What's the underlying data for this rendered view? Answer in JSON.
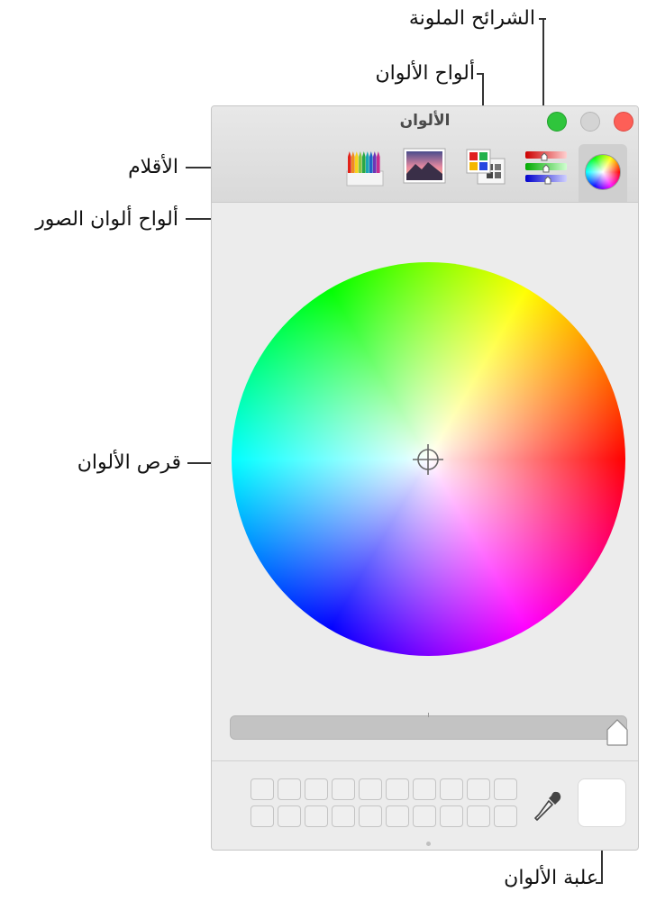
{
  "window": {
    "title": "الألوان"
  },
  "toolbar": {
    "tabs": [
      {
        "id": "color-wheel",
        "icon": "color-wheel-icon",
        "selected": true
      },
      {
        "id": "color-sliders",
        "icon": "sliders-icon",
        "selected": false
      },
      {
        "id": "color-palettes",
        "icon": "palette-icon",
        "selected": false
      },
      {
        "id": "image-palettes",
        "icon": "image-icon",
        "selected": false
      },
      {
        "id": "pencils",
        "icon": "pencils-icon",
        "selected": false
      }
    ]
  },
  "callouts": {
    "color_sliders": "الشرائح الملونة",
    "color_palettes": "ألواح الألوان",
    "pencils": "الأقلام",
    "image_palettes": "ألواح ألوان الصور",
    "color_wheel": "قرص الألوان",
    "color_well": "علبة الألوان"
  },
  "colors": {
    "close": "#fd5f57",
    "minimize": "#d4d4d4",
    "zoom": "#2fc53c",
    "selected_color": "#ffffff"
  },
  "brightness_slider": {
    "value": 1.0
  },
  "swatches": {
    "rows": 2,
    "columns": 10
  }
}
